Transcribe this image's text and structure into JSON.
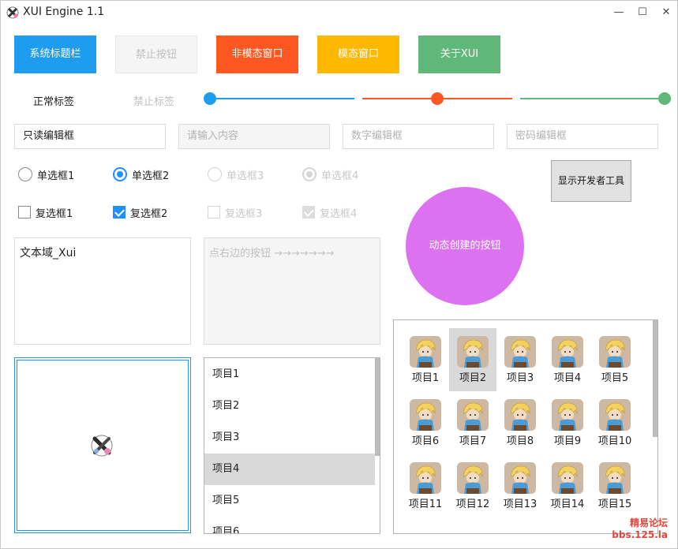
{
  "window": {
    "title": "XUI Engine 1.1",
    "controls": {
      "minimize": "—",
      "maximize": "☐",
      "close": "✕"
    }
  },
  "buttons": [
    {
      "label": "系统标题栏",
      "color": "#1e9cf0"
    },
    {
      "label": "禁止按钮",
      "disabled": true
    },
    {
      "label": "非模态窗口",
      "color": "#ff5722"
    },
    {
      "label": "模态窗口",
      "color": "#ffb800"
    },
    {
      "label": "关于XUI",
      "color": "#5fb878"
    }
  ],
  "labels": {
    "normal": "正常标签",
    "disabled": "禁止标签"
  },
  "sliders": [
    {
      "color": "#1e9cf0",
      "value": 0.0
    },
    {
      "color": "#ff5722",
      "value": 0.5
    },
    {
      "color": "#5fb878",
      "value": 1.0
    }
  ],
  "edits": {
    "readonly": "只读编辑框",
    "placeholder": "请输入内容",
    "numeric_placeholder": "数字编辑框",
    "password_placeholder": "密码编辑框"
  },
  "radios": [
    "单选框1",
    "单选框2",
    "单选框3",
    "单选框4"
  ],
  "checks": [
    "复选框1",
    "复选框2",
    "复选框3",
    "复选框4"
  ],
  "textarea": {
    "value": "文本域_Xui",
    "disabled_text": "点右边的按钮 →→→→→→→"
  },
  "devtools_button": "显示开发者工具",
  "dynamic_button": "动态创建的按钮",
  "list": {
    "items": [
      "项目1",
      "项目2",
      "项目3",
      "项目4",
      "项目5",
      "项目6"
    ],
    "selected": 3
  },
  "grid": {
    "items": [
      "项目1",
      "项目2",
      "项目3",
      "项目4",
      "项目5",
      "项目6",
      "项目7",
      "项目8",
      "项目9",
      "项目10",
      "项目11",
      "项目12",
      "项目13",
      "项目14",
      "项目15"
    ],
    "selected": 1
  },
  "watermark": {
    "line1": "精易论坛",
    "line2": "bbs.125.la"
  }
}
